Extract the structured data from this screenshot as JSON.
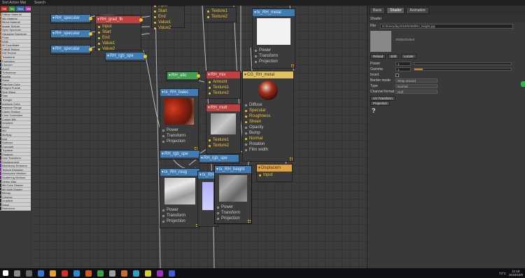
{
  "topbar": {
    "menu": "Sort Action Mat",
    "search": "Search"
  },
  "tags": [
    {
      "label": "Std",
      "color": "#c03030"
    },
    {
      "label": "Tex",
      "color": "#3a8a3a"
    },
    {
      "label": "Geo",
      "color": "#3a6ab0"
    },
    {
      "label": "Mat",
      "color": "#b03aa0"
    },
    {
      "label": "Dis",
      "color": "#6a4ab0"
    },
    {
      "label": "Em",
      "color": "#3a9aa0"
    },
    {
      "label": "Vol",
      "color": "#4a8ad0"
    }
  ],
  "left_items": [
    {
      "label": "Diffuse Material",
      "mark": "#8a5a2a"
    },
    {
      "label": "Mix Material",
      "mark": "#8a5a2a"
    },
    {
      "label": "Blend Material",
      "mark": "#8a5a2a"
    },
    {
      "label": "Image Texture",
      "mark": "#8a5a2a"
    },
    {
      "label": "Spec Spectrum",
      "mark": "#8a5a2a"
    },
    {
      "label": "Gaussian Spectrum",
      "mark": "#8a5a2a"
    },
    {
      "label": "Float",
      "mark": "#8a5a2a"
    },
    {
      "label": "RGB",
      "mark": "#8a5a2a"
    },
    {
      "label": "W Coordinate",
      "mark": "#8a5a2a"
    },
    {
      "label": "Falloff Texture",
      "mark": "#8a5a2a"
    },
    {
      "label": "Dirt Texture",
      "mark": "#8a5a2a"
    },
    {
      "label": "Transform",
      "mark": "#8a5a2a"
    },
    {
      "label": "Projection",
      "mark": "#2a2a2a"
    },
    {
      "label": "Checker",
      "mark": "#2a2a2a"
    },
    {
      "label": "Invert",
      "mark": "#2a2a2a"
    },
    {
      "label": "Turbulence",
      "mark": "#2a2a2a"
    },
    {
      "label": "Marble",
      "mark": "#2a2a2a"
    },
    {
      "label": "Noise",
      "mark": "#2a2a2a"
    },
    {
      "label": "Random Color",
      "mark": "#2a2a2a"
    },
    {
      "label": "Ridged Fractal",
      "mark": "#2a2a2a"
    },
    {
      "label": "Sine Wave",
      "mark": "#2a2a2a"
    },
    {
      "label": "Saw",
      "mark": "#2a2a2a"
    },
    {
      "label": "Triangle",
      "mark": "#2a2a2a"
    },
    {
      "label": "Instance Color",
      "mark": "#2a2a2a"
    },
    {
      "label": "Instance Range",
      "mark": "#2a2a2a"
    },
    {
      "label": "Clamp Texture",
      "mark": "#2a2a2a"
    },
    {
      "label": "Color Correction",
      "mark": "#2a2a2a"
    },
    {
      "label": "Cosine Mix",
      "mark": "#2a2a2a"
    },
    {
      "label": "Gradient",
      "mark": "#2a2a2a"
    },
    {
      "label": "Invert",
      "mark": "#2a2a2a"
    },
    {
      "label": "Mix",
      "mark": "#2a2a2a"
    },
    {
      "label": "Multiply",
      "mark": "#2a2a2a"
    },
    {
      "label": "Add",
      "mark": "#2a2a2a"
    },
    {
      "label": "Subtract",
      "mark": "#2a2a2a"
    },
    {
      "label": "Compare",
      "mark": "#2a2a2a"
    },
    {
      "label": "Triplanar",
      "mark": "#2a2a2a"
    },
    {
      "label": "Distance",
      "mark": "#2a2a2a"
    },
    {
      "label": "Uvw Transform",
      "mark": "#2a2a2a"
    },
    {
      "label": "Displacement",
      "mark": "#6a2a8a"
    },
    {
      "label": "Blackbody Emission",
      "mark": "#6a2a8a"
    },
    {
      "label": "Texture Emission",
      "mark": "#6a2a8a"
    },
    {
      "label": "Absorption Medium",
      "mark": "#6a2a8a"
    },
    {
      "label": "Scattering Medium",
      "mark": "#6a2a8a"
    },
    {
      "label": "Vertex Map",
      "mark": "#2a2a2a"
    },
    {
      "label": "Mtl Color Shader",
      "mark": "#2a2a2a"
    },
    {
      "label": "Mtl Multi Shader",
      "mark": "#2a2a2a"
    },
    {
      "label": "Bitmap",
      "mark": "#2a2a2a"
    },
    {
      "label": "Colorize",
      "mark": "#2a2a2a"
    },
    {
      "label": "Gradient",
      "mark": "#2a2a2a"
    },
    {
      "label": "Noise",
      "mark": "#2a2a2a"
    },
    {
      "label": "Reference",
      "mark": "#2a2a2a"
    }
  ],
  "nodes": {
    "spec1": {
      "title": "RH_specular"
    },
    "spec2": {
      "title": "RH_specular"
    },
    "spec3": {
      "title": "RH_specular"
    },
    "grad": {
      "title": "RH_grad_fb",
      "pins": [
        "Input",
        "Start",
        "End",
        "Value1",
        "Value2"
      ]
    },
    "top": {
      "pins": [
        "Input",
        "Start",
        "End",
        "Value1",
        "Value2"
      ]
    },
    "rgbspe1": {
      "title": "RH_rgb_spe"
    },
    "tex12": {
      "pins": [
        "Texture1",
        "Texture2"
      ]
    },
    "txmetal": {
      "title": "tx_RH_metal",
      "pins": [
        "Power",
        "Transform",
        "Projection"
      ]
    },
    "rhallo": {
      "title": "RH_allo"
    },
    "rhmix": {
      "title": "RH_mix",
      "pins": [
        "Amount",
        "Texture1",
        "Texture2"
      ]
    },
    "txbalec": {
      "title": "tx_RH_balec",
      "pins": [
        "Power",
        "Transform",
        "Projection"
      ]
    },
    "rhmult": {
      "title": "RH_mult",
      "pins": [
        "Texture1",
        "Texture2"
      ]
    },
    "mat": {
      "title": "CG_RH_metal",
      "pins": [
        "Diffuse",
        "Specular",
        "Roughness",
        "Sheen",
        "Opacity",
        "Bump",
        "Normal",
        "Rotation",
        "Film width"
      ]
    },
    "rgbspe2": {
      "title": "RH_rgb_spe"
    },
    "rgbspe3": {
      "title": "RH_rgb_spe"
    },
    "txroug": {
      "title": "tx_RH_roug",
      "pins": [
        "Power",
        "Transform",
        "Projection"
      ]
    },
    "txrh": {
      "title": "tx_RH"
    },
    "txheight": {
      "title": "tx_RH_height",
      "pins": [
        "Power",
        "Transform",
        "Projection"
      ]
    },
    "displace": {
      "title": "Displacem",
      "pins": [
        "Input"
      ]
    }
  },
  "right": {
    "tabs": [
      "Basic",
      "Shader",
      "Animation"
    ],
    "section": "Shader",
    "file_label": "File",
    "file_path": "D:/Everyday2018/0009/RH_height.jpg",
    "img_info": "2048x2048x8",
    "buttons": [
      "Reload",
      "Edit",
      "Locate"
    ],
    "power_label": "Power",
    "power_value": "1",
    "gamma_label": "Gamma",
    "gamma_value": "1",
    "invert_label": "Invert",
    "border_label": "Border mode",
    "border_value": "Wrap around",
    "type_label": "Type",
    "type_value": "Normal",
    "channel_label": "Channel format",
    "channel_value": "Half",
    "uvw_button": "UV Transform",
    "proj_button": "Projection",
    "help": "?"
  },
  "tray": {
    "temp": "73°C",
    "time": "11:18",
    "date": "2018/10/9"
  }
}
